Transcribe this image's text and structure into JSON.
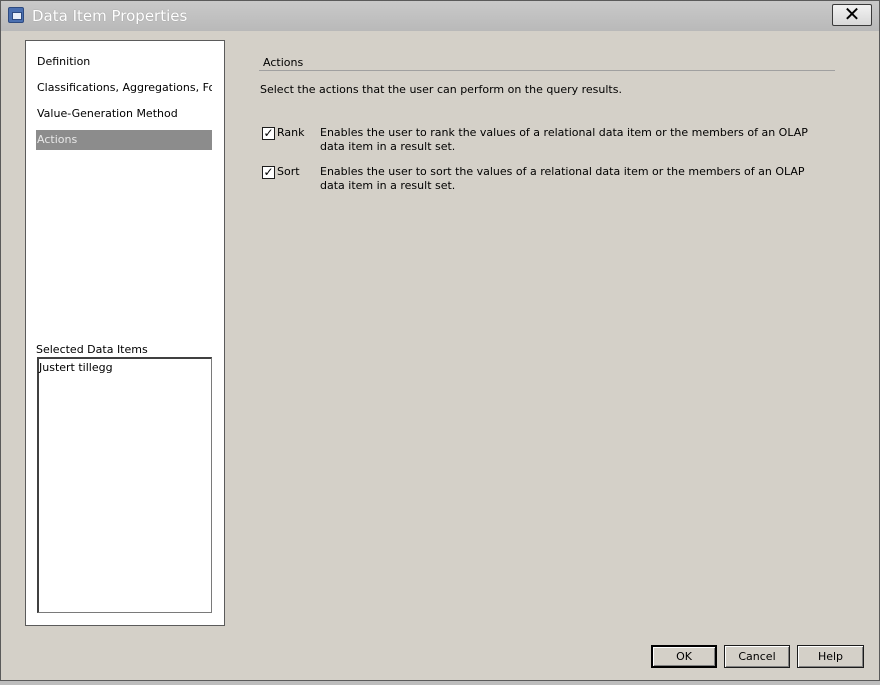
{
  "window": {
    "title": "Data Item Properties",
    "close_glyph": "✕"
  },
  "sidebar": {
    "items": [
      {
        "label": "Definition"
      },
      {
        "label": "Classifications, Aggregations, For…"
      },
      {
        "label": "Value-Generation Method"
      },
      {
        "label": "Actions",
        "selected": true
      }
    ],
    "selected_items_label": "Selected Data Items",
    "selected_items": [
      "Justert tillegg"
    ]
  },
  "main": {
    "section_title": "Actions",
    "intro": "Select the actions that the user can perform on the query results.",
    "options": [
      {
        "label": "Rank",
        "checked": true,
        "check_glyph": "✓",
        "description": "Enables the user to rank the values of a relational data item or the members of an OLAP data item in a result set."
      },
      {
        "label": "Sort",
        "checked": true,
        "check_glyph": "✓",
        "description": "Enables the user to sort the values of a relational data item or the members of an OLAP data item in a result set."
      }
    ]
  },
  "footer": {
    "ok_label": "OK",
    "cancel_label": "Cancel",
    "help_label": "Help"
  }
}
